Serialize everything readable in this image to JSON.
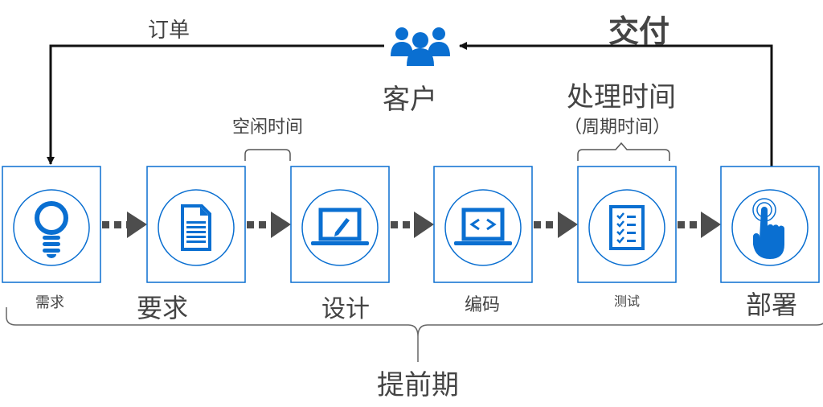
{
  "colors": {
    "accent": "#0a6fd1",
    "arrow": "#4d4d4d",
    "line": "#111111",
    "text": "#444444"
  },
  "labels": {
    "order": "订单",
    "customer": "客户",
    "delivery": "交付",
    "idle_time": "空闲时间",
    "process_time": "处理时间",
    "cycle_time": "（周期时间）",
    "lead_time": "提前期"
  },
  "stages": [
    {
      "label": "需求",
      "icon": "lightbulb-icon"
    },
    {
      "label": "要求",
      "icon": "document-icon"
    },
    {
      "label": "设计",
      "icon": "laptop-pencil-icon"
    },
    {
      "label": "编码",
      "icon": "laptop-code-icon"
    },
    {
      "label": "测试",
      "icon": "checklist-icon"
    },
    {
      "label": "部署",
      "icon": "touch-hand-icon"
    }
  ],
  "customer_icon": "people-icon"
}
